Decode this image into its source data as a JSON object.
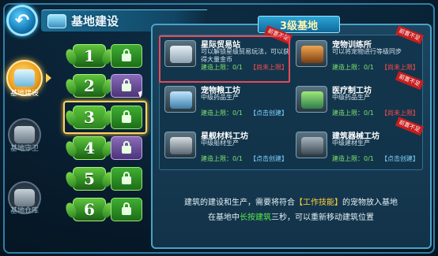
{
  "header": {
    "title": "基地建设",
    "back_icon": "back-arrow-icon"
  },
  "categories": [
    {
      "label": "基地建设",
      "icon": "base-building-icon",
      "active": true
    },
    {
      "label": "基地守卫",
      "icon": "guard-robot-icon",
      "active": false
    },
    {
      "label": "基地仓库",
      "icon": "storage-box-icon",
      "active": false
    }
  ],
  "levels": [
    {
      "num": "1",
      "lock": "lock-icon",
      "selected": false
    },
    {
      "num": "2",
      "lock": "lock-icon",
      "selected": false
    },
    {
      "num": "3",
      "lock": "lock-icon",
      "selected": true
    },
    {
      "num": "4",
      "lock": "lock-icon",
      "selected": false
    },
    {
      "num": "5",
      "lock": "lock-icon",
      "selected": false
    },
    {
      "num": "6",
      "lock": "lock-icon",
      "selected": false
    }
  ],
  "panel": {
    "title": "3级基地",
    "buildings": [
      {
        "name": "星际贸易站",
        "desc": "可以解锁星级贸易玩法，可以获得大量金币",
        "limit": "建造上限：0/1",
        "action": "【尚未上限】",
        "action_color": "red",
        "ribbon": "前置不足"
      },
      {
        "name": "宠物训练所",
        "desc": "可以将宠物进行等级同步",
        "limit": "建造上限：0/1",
        "action": "【尚未上限】",
        "action_color": "red",
        "ribbon": "前置不足"
      },
      {
        "name": "宠物粮工坊",
        "desc": "中级药品生产",
        "limit": "建造上限：0/1",
        "action": "【点击创建】",
        "action_color": "blue",
        "ribbon": ""
      },
      {
        "name": "医疗制工坊",
        "desc": "中级药品生产",
        "limit": "建造上限：0/1",
        "action": "【尚未上限】",
        "action_color": "red",
        "ribbon": "前置不足"
      },
      {
        "name": "星舰材料工坊",
        "desc": "中级船材生产",
        "limit": "建造上限：0/1",
        "action": "【点击创建】",
        "action_color": "blue",
        "ribbon": ""
      },
      {
        "name": "建筑器械工坊",
        "desc": "中级建材生产",
        "limit": "建造上限：0/1",
        "action": "【点击创建】",
        "action_color": "blue",
        "ribbon": "前置不足"
      }
    ],
    "info": {
      "line1_pre": "建筑的建设和生产，需要将符合",
      "line1_kw": "【工作技能】",
      "line1_post": "的宠物放入基地",
      "line2_pre": "在基地中",
      "line2_kw": "长按建筑",
      "line2_post": "三秒，可以重新移动建筑位置"
    }
  },
  "colors": {
    "accent": "#2f7fa6",
    "level_green": "#3fae33",
    "select_gold": "#ffd45e",
    "warn_red": "#ff4a4a",
    "keyword_yellow": "#ffd23d",
    "keyword_green": "#5bea4c"
  }
}
